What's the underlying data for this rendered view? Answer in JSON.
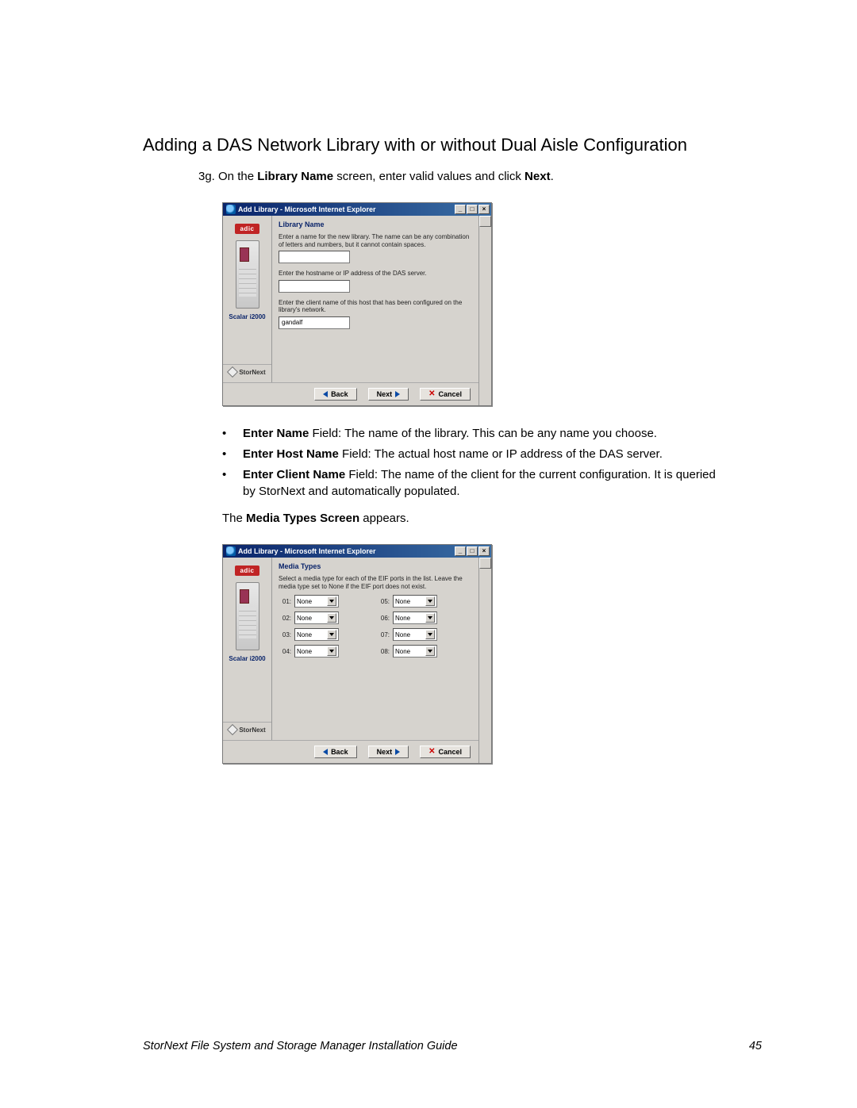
{
  "heading": "Adding a DAS Network Library with or without Dual Aisle Configuration",
  "step": {
    "prefix": "3g. On the ",
    "bold1": "Library Name",
    "mid": " screen, enter valid values and click ",
    "bold2": "Next",
    "suffix": "."
  },
  "dialog1": {
    "title": "Add Library - Microsoft Internet Explorer",
    "sidebar_adic": "adic",
    "scalar": "Scalar i2000",
    "stornext": "StorNext",
    "header": "Library Name",
    "desc": "Enter a name for the new library. The name can be any combination of letters and numbers, but it cannot contain spaces.",
    "host_label": "Enter the hostname or IP address of the DAS server.",
    "client_label": "Enter the client name of this host that has been configured on the library's network.",
    "client_value": "gandalf",
    "back": "Back",
    "next": "Next",
    "cancel": "Cancel"
  },
  "bullets": [
    {
      "bold": "Enter Name",
      "rest": " Field: The name of the library. This can be any name you choose."
    },
    {
      "bold": "Enter Host Name",
      "rest": " Field: The actual host name or IP address of the DAS server."
    },
    {
      "bold": "Enter Client Name",
      "rest": " Field: The name of the client for the current configuration. It is queried by StorNext and automatically populated."
    }
  ],
  "after_bullets": {
    "pre": "The ",
    "bold": "Media Types Screen",
    "post": " appears."
  },
  "dialog2": {
    "title": "Add Library - Microsoft Internet Explorer",
    "header": "Media Types",
    "desc": "Select a media type for each of the EIF ports in the list. Leave the media type set to None if the EIF port does not exist.",
    "rows": [
      {
        "l": "01:",
        "lv": "None",
        "r": "05:",
        "rv": "None"
      },
      {
        "l": "02:",
        "lv": "None",
        "r": "06:",
        "rv": "None"
      },
      {
        "l": "03:",
        "lv": "None",
        "r": "07:",
        "rv": "None"
      },
      {
        "l": "04:",
        "lv": "None",
        "r": "08:",
        "rv": "None"
      }
    ],
    "back": "Back",
    "next": "Next",
    "cancel": "Cancel"
  },
  "footer": {
    "left": "StorNext File System and Storage Manager Installation Guide",
    "right": "45"
  }
}
